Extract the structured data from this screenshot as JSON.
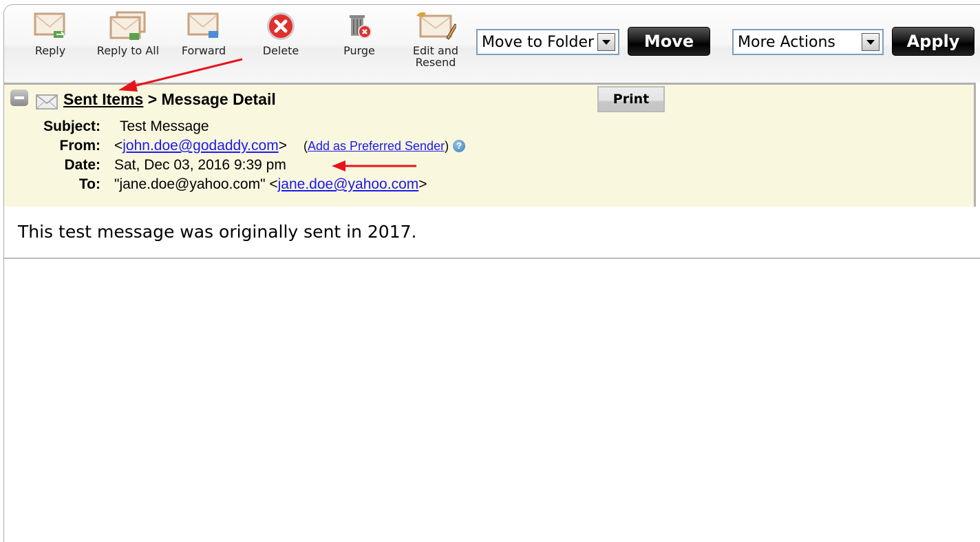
{
  "toolbar": {
    "buttons": [
      {
        "id": "reply",
        "label": "Reply",
        "icon": "reply-icon"
      },
      {
        "id": "reply-all",
        "label": "Reply to All",
        "icon": "reply-all-icon"
      },
      {
        "id": "forward",
        "label": "Forward",
        "icon": "forward-icon"
      },
      {
        "id": "delete",
        "label": "Delete",
        "icon": "delete-icon"
      },
      {
        "id": "purge",
        "label": "Purge",
        "icon": "purge-icon"
      },
      {
        "id": "edit-resend",
        "label_line1": "Edit and",
        "label_line2": "Resend",
        "icon": "edit-resend-icon"
      }
    ],
    "move_folder_select": {
      "value": "Move to Folder"
    },
    "move_label": "Move",
    "more_actions_select": {
      "value": "More Actions"
    },
    "apply_label": "Apply"
  },
  "message": {
    "breadcrumb": {
      "folder": "Sent Items",
      "separator": " > ",
      "current": "Message Detail"
    },
    "print_label": "Print",
    "headers": {
      "subject_label": "Subject:",
      "subject": "Test Message",
      "from_label": "From:",
      "from_prefix": "<",
      "from_email": "john.doe@godaddy.com",
      "from_suffix": ">",
      "preferred_open": "(",
      "preferred_link": "Add as Preferred Sender",
      "preferred_close": ")",
      "help_icon": "?",
      "date_label": "Date:",
      "date": "Sat, Dec 03, 2016 9:39 pm",
      "to_label": "To:",
      "to_name": "\"jane.doe@yahoo.com\" <",
      "to_email": "jane.doe@yahoo.com",
      "to_suffix": ">"
    },
    "body": "This test message was originally sent in 2017."
  },
  "annotations": {
    "arrow_color": "#e8141b"
  }
}
